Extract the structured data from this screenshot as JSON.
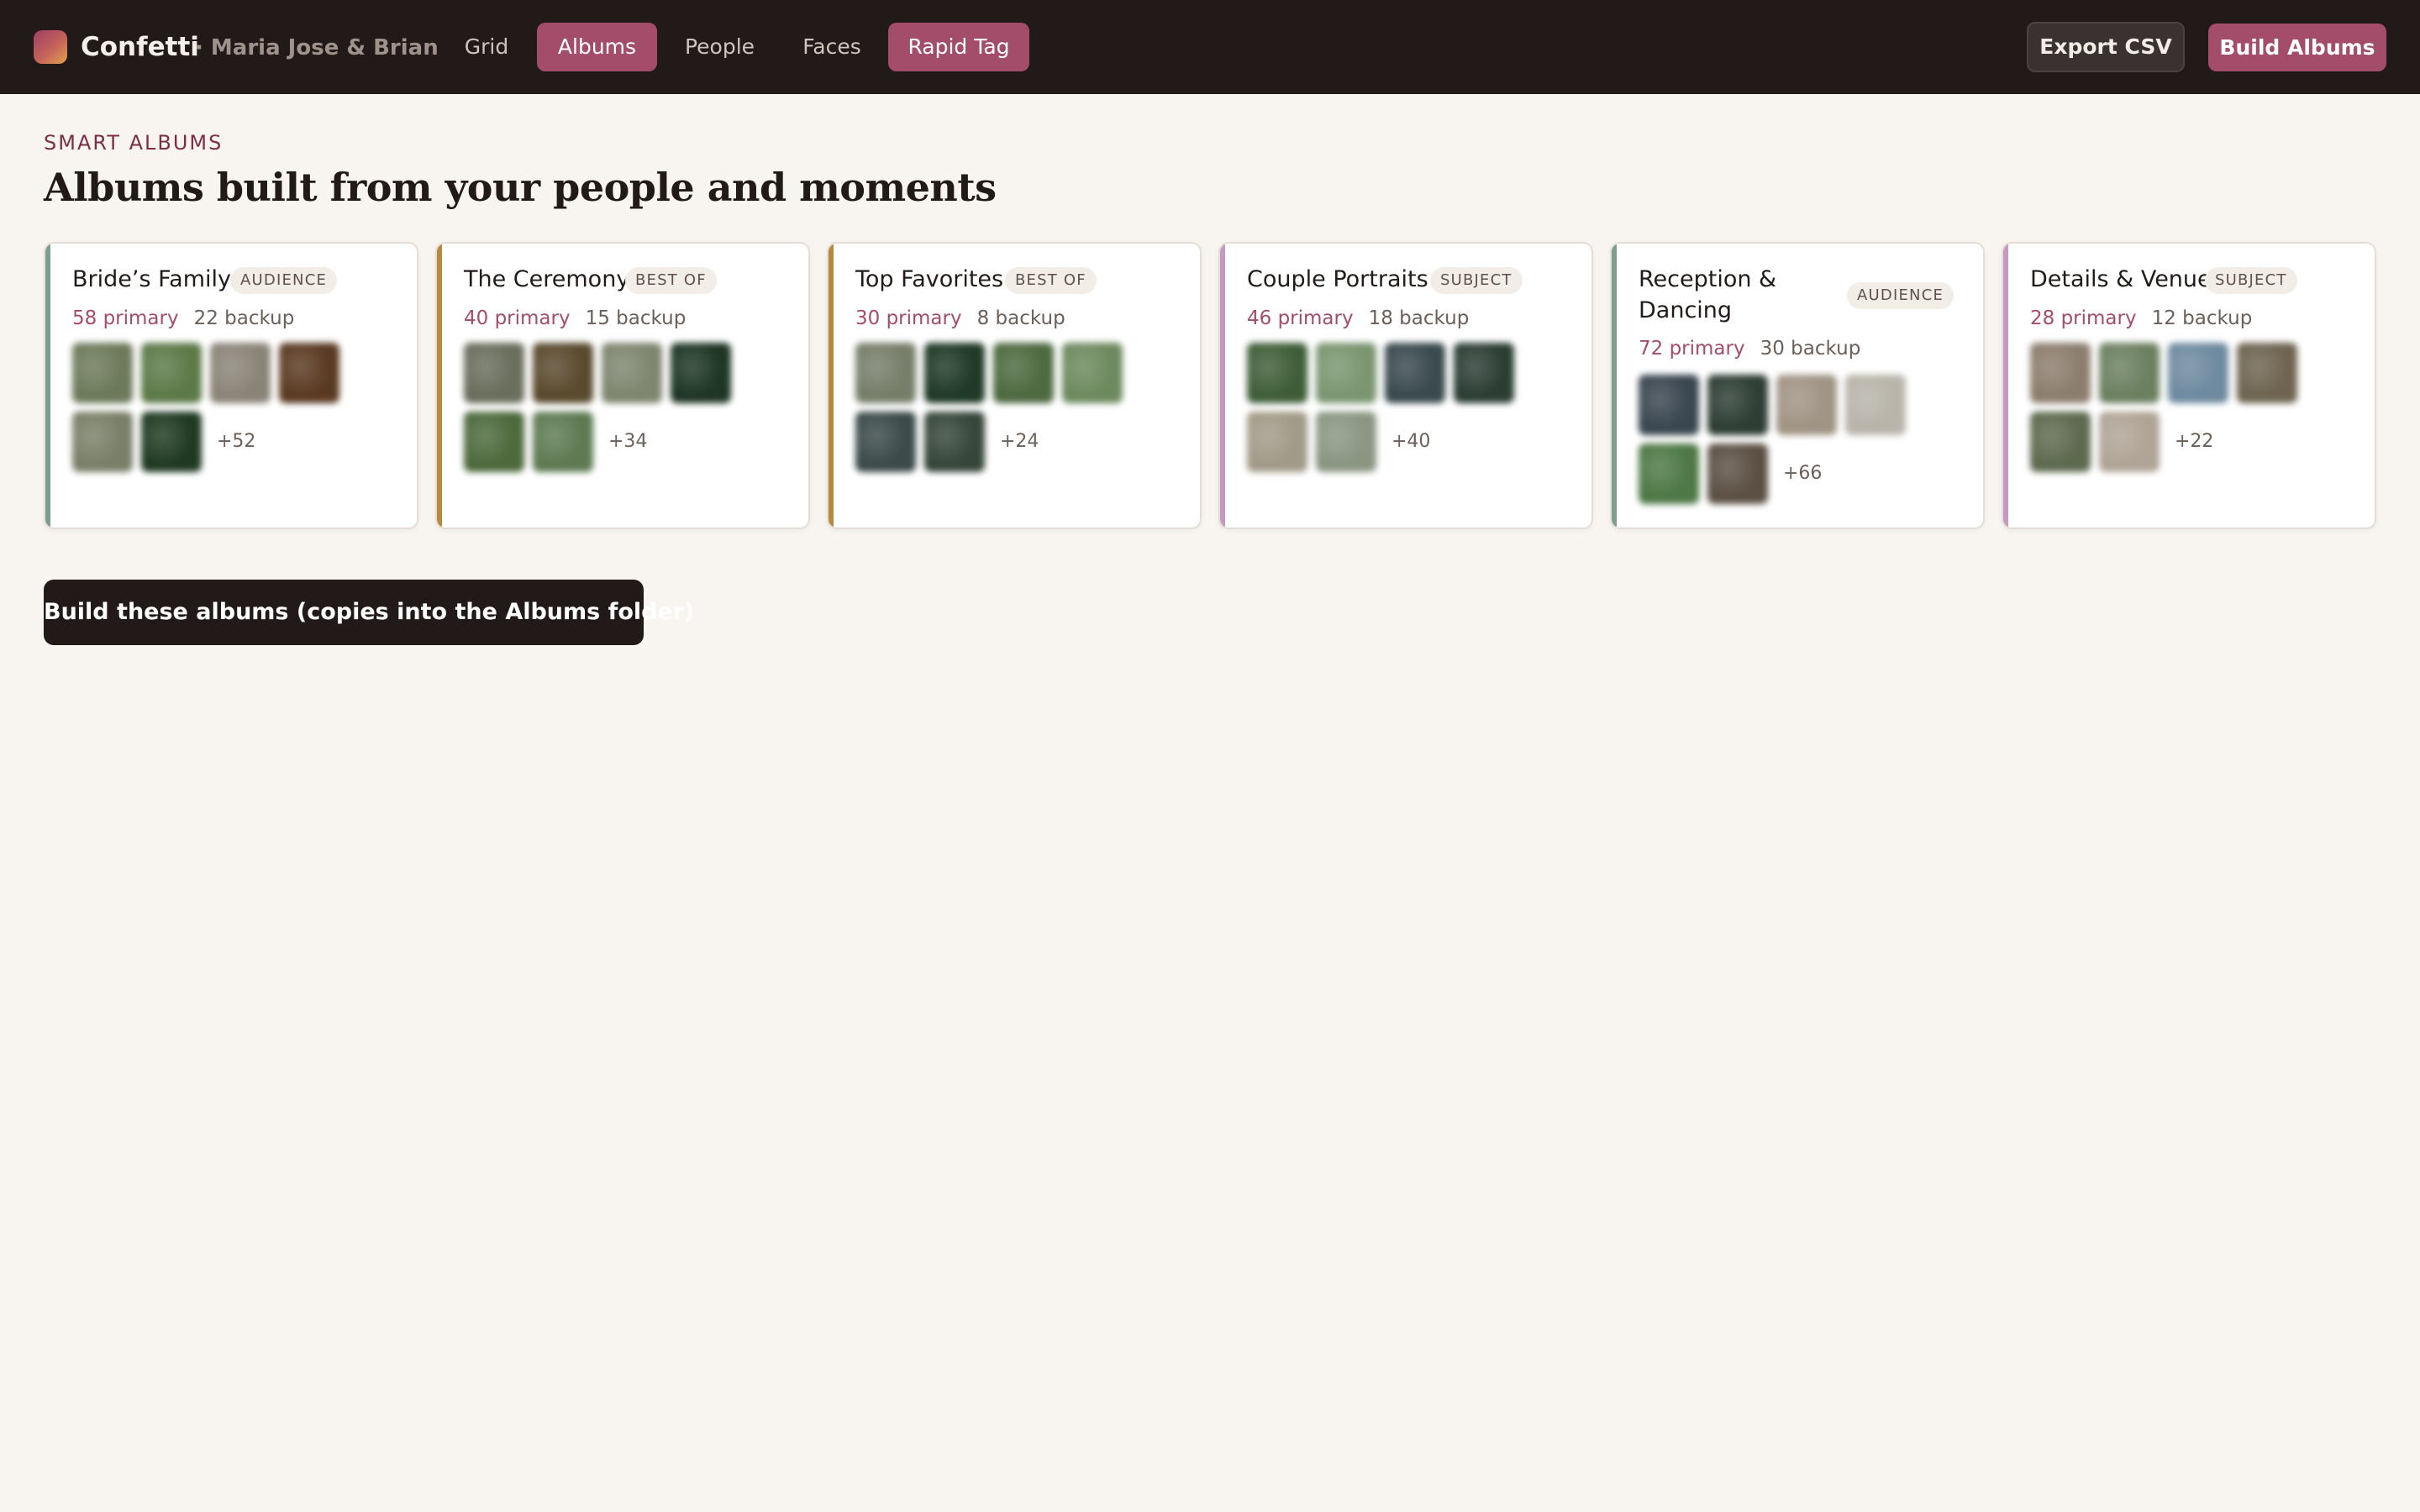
{
  "app": {
    "name": "Confetti",
    "project": "· Maria Jose & Brian"
  },
  "nav": {
    "items": [
      {
        "label": "Grid",
        "active": false
      },
      {
        "label": "Albums",
        "active": true
      },
      {
        "label": "People",
        "active": false
      },
      {
        "label": "Faces",
        "active": false
      },
      {
        "label": "Rapid Tag",
        "active": true
      }
    ]
  },
  "header_actions": {
    "export_label": "Export CSV",
    "build_label": "Build Albums"
  },
  "section": {
    "eyebrow": "SMART ALBUMS",
    "title": "Albums built from your people and moments"
  },
  "albums": [
    {
      "title": "Bride’s Family",
      "tag": "AUDIENCE",
      "primary": "58 primary",
      "backup": "22 backup",
      "more": "+52",
      "accent": "#7b9e8f",
      "thumbs": [
        "#6d7a5a",
        "#5c7a48",
        "#8a8478",
        "#5a3a22",
        "#7a7f68",
        "#1f3a22"
      ]
    },
    {
      "title": "The Ceremony",
      "tag": "BEST OF",
      "primary": "40 primary",
      "backup": "15 backup",
      "more": "+34",
      "accent": "#b58a3e",
      "thumbs": [
        "#6a6e5c",
        "#5a4a2e",
        "#7e8670",
        "#1e3624",
        "#4d6a3c",
        "#5e7a52"
      ]
    },
    {
      "title": "Top Favorites",
      "tag": "BEST OF",
      "primary": "30 primary",
      "backup": "8 backup",
      "more": "+24",
      "accent": "#b58a3e",
      "thumbs": [
        "#767e6a",
        "#1f3a26",
        "#4d6a40",
        "#6c8a5e",
        "#3c4a4a",
        "#36463a"
      ]
    },
    {
      "title": "Couple Portraits",
      "tag": "SUBJECT",
      "primary": "46 primary",
      "backup": "18 backup",
      "more": "+40",
      "accent": "#c49ac0",
      "thumbs": [
        "#3f5e38",
        "#7a9670",
        "#3a4a4e",
        "#2c3e34",
        "#a29a88",
        "#8a9682"
      ]
    },
    {
      "title": "Reception & Dancing",
      "tag": "AUDIENCE",
      "primary": "72 primary",
      "backup": "30 backup",
      "more": "+66",
      "accent": "#7b9e8f",
      "thumbs": [
        "#3a4650",
        "#2e3e34",
        "#a09484",
        "#b8b4aa",
        "#4e7846",
        "#5c5044"
      ]
    },
    {
      "title": "Details & Venue",
      "tag": "SUBJECT",
      "primary": "28 primary",
      "backup": "12 backup",
      "more": "+22",
      "accent": "#c49ac0",
      "thumbs": [
        "#8c7e6e",
        "#6c8060",
        "#6e8aa0",
        "#6e6450",
        "#5e6a4e",
        "#b0a496"
      ]
    }
  ],
  "build_button": {
    "label": "Build these albums (copies into the Albums folder)"
  }
}
